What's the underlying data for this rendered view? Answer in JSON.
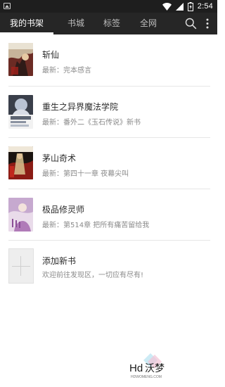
{
  "status_bar": {
    "time": "2:54"
  },
  "tabs": [
    {
      "label": "我的书架",
      "active": true
    },
    {
      "label": "书城",
      "active": false
    },
    {
      "label": "标签",
      "active": false
    },
    {
      "label": "全网",
      "active": false
    }
  ],
  "icons": {
    "search": "search-icon",
    "more": "more-vert-icon"
  },
  "books": [
    {
      "title": "斩仙",
      "latest": "最新：完本感言",
      "cover_text": "斩仙"
    },
    {
      "title": "重生之异界魔法学院",
      "latest": "最新：番外二《玉石传说》新书",
      "cover_text": ""
    },
    {
      "title": "茅山奇术",
      "latest": "最新：第四十一章 夜幕尖叫",
      "cover_text": ""
    },
    {
      "title": "极品修灵师",
      "latest": "最新：第514章 把所有痛苦留给我",
      "cover_text": "极品修灵师"
    }
  ],
  "add_book": {
    "title": "添加新书",
    "subtitle": "欢迎前往发现区，一切应有尽有!"
  },
  "watermark": {
    "text": "Hd沃梦",
    "subtext": "HDWOMENG.COM"
  },
  "colors": {
    "appbar": "#262626",
    "statusbar": "#1e1e1e",
    "active_tab": "#ffffff",
    "inactive_tab": "#bdbdbd"
  }
}
